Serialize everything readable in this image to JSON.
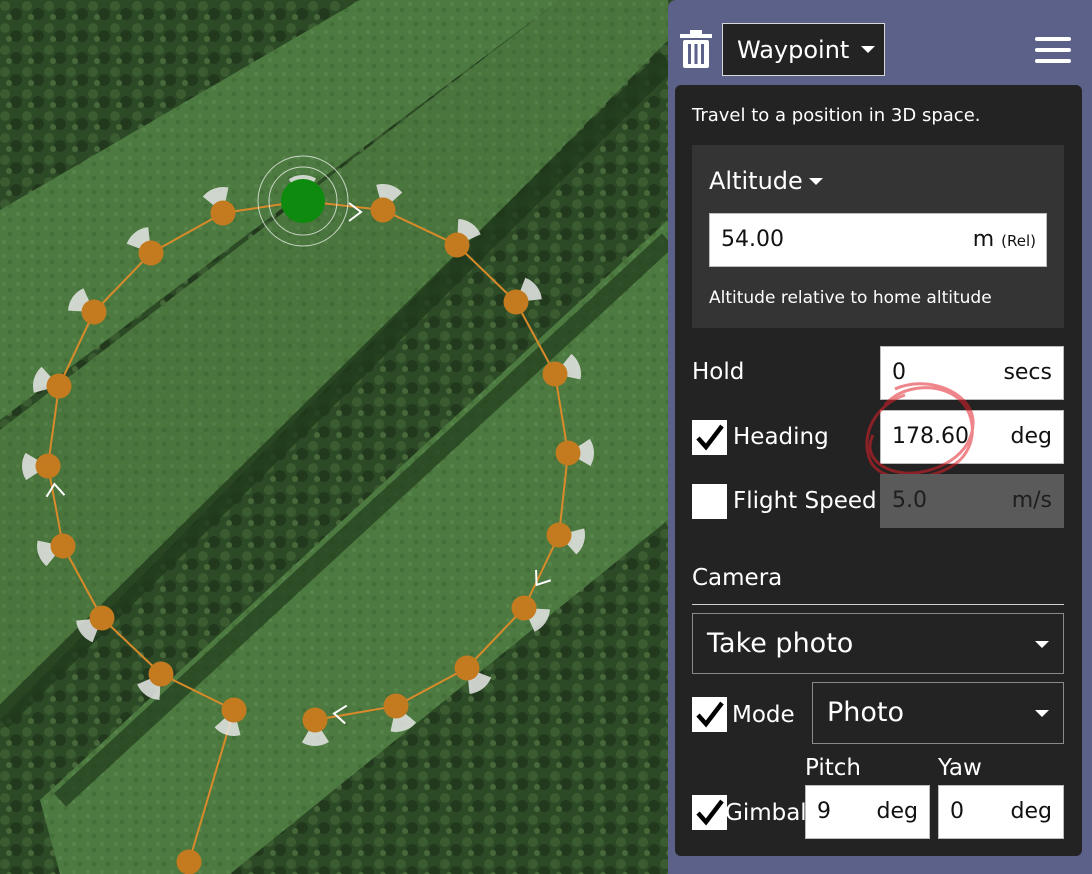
{
  "toolbar": {
    "item_type": "Waypoint"
  },
  "editor": {
    "description": "Travel to a position in 3D space.",
    "altitude": {
      "label": "Altitude",
      "value": "54.00",
      "unit": "m",
      "reference": "(Rel)",
      "help": "Altitude relative to home altitude"
    },
    "hold": {
      "label": "Hold",
      "value": "0",
      "unit": "secs"
    },
    "heading": {
      "label": "Heading",
      "checked": true,
      "value": "178.60",
      "unit": "deg"
    },
    "flight_speed": {
      "label": "Flight Speed",
      "checked": false,
      "value": "5.0",
      "unit": "m/s"
    },
    "camera": {
      "section_label": "Camera",
      "action": "Take photo",
      "mode": {
        "label": "Mode",
        "checked": true,
        "value": "Photo"
      },
      "gimbal": {
        "label": "Gimbal",
        "checked": true,
        "pitch_label": "Pitch",
        "pitch_value": "9",
        "pitch_unit": "deg",
        "yaw_label": "Yaw",
        "yaw_value": "0",
        "yaw_unit": "deg"
      }
    }
  },
  "colors": {
    "panel_bg": "#5b6188",
    "editor_bg": "#232323",
    "waypoint": "#c47a1e",
    "current_waypoint": "#0e8a0e",
    "path": "#d98a2a",
    "annotation": "#e0202a"
  },
  "icons": [
    "trash-icon",
    "chevron-down-icon",
    "hamburger-menu-icon",
    "checkmark-icon"
  ]
}
